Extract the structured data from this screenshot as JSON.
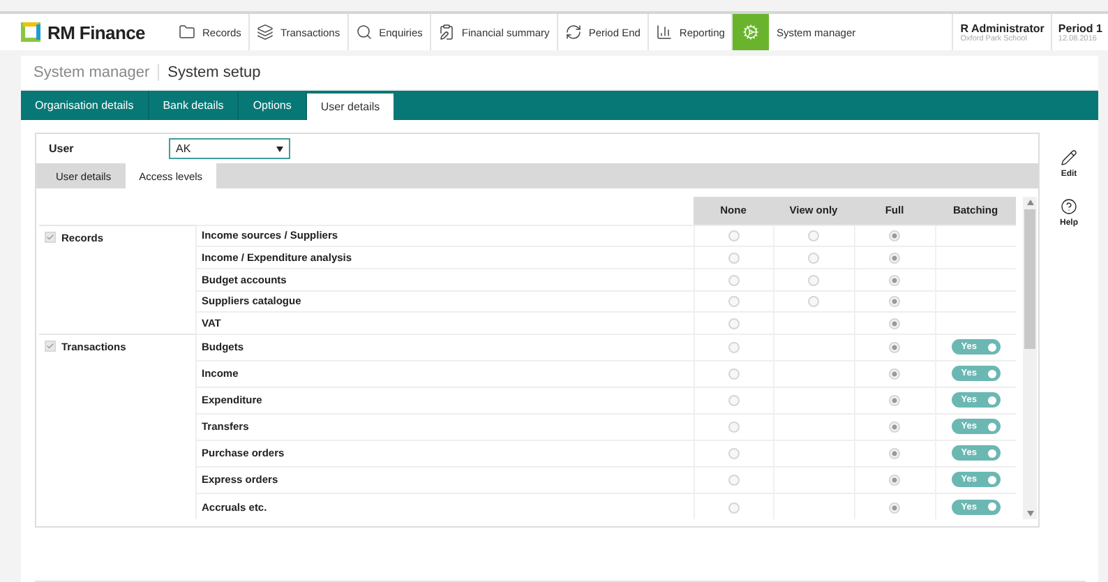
{
  "app": {
    "name": "RM Finance"
  },
  "nav": [
    {
      "kind": "records",
      "label": "Records",
      "selected": false
    },
    {
      "kind": "transactions",
      "label": "Transactions",
      "selected": false
    },
    {
      "kind": "enquiries",
      "label": "Enquiries",
      "selected": false
    },
    {
      "kind": "summary",
      "label": "Financial summary",
      "selected": false
    },
    {
      "kind": "period",
      "label": "Period End",
      "selected": false
    },
    {
      "kind": "reporting",
      "label": "Reporting",
      "selected": false
    },
    {
      "kind": "system",
      "label": "System manager",
      "selected": true
    }
  ],
  "user": {
    "name": "R Administrator",
    "org": "Oxford Park School"
  },
  "period": {
    "label": "Period 1",
    "date": "12.08.2016"
  },
  "breadcrumb": {
    "parent": "System manager",
    "current": "System setup"
  },
  "tabs": [
    {
      "label": "Organisation details",
      "selected": false
    },
    {
      "label": "Bank details",
      "selected": false
    },
    {
      "label": "Options",
      "selected": false
    },
    {
      "label": "User details",
      "selected": true
    }
  ],
  "user_field": {
    "label": "User",
    "value": "AK"
  },
  "subtabs": [
    {
      "label": "User details",
      "selected": false
    },
    {
      "label": "Access levels",
      "selected": true
    }
  ],
  "columns": [
    "None",
    "View only",
    "Full",
    "Batching"
  ],
  "groups": [
    {
      "name": "Records",
      "checked": true,
      "items": [
        {
          "label": "Income sources / Suppliers",
          "levels": [
            {
              "kind": "none",
              "selected": false
            },
            {
              "kind": "view",
              "selected": false
            },
            {
              "kind": "full",
              "selected": true
            }
          ]
        },
        {
          "label": "Income / Expenditure analysis",
          "levels": [
            {
              "kind": "none",
              "selected": false
            },
            {
              "kind": "view",
              "selected": false
            },
            {
              "kind": "full",
              "selected": true
            }
          ]
        },
        {
          "label": "Budget accounts",
          "levels": [
            {
              "kind": "none",
              "selected": false
            },
            {
              "kind": "view",
              "selected": false
            },
            {
              "kind": "full",
              "selected": true
            }
          ]
        },
        {
          "label": "Suppliers catalogue",
          "levels": [
            {
              "kind": "none",
              "selected": false
            },
            {
              "kind": "view",
              "selected": false
            },
            {
              "kind": "full",
              "selected": true
            }
          ]
        },
        {
          "label": "VAT",
          "levels": [
            {
              "kind": "none",
              "selected": false
            },
            {
              "kind": "full",
              "selected": true
            }
          ]
        }
      ]
    },
    {
      "name": "Transactions",
      "checked": true,
      "items": [
        {
          "label": "Budgets",
          "levels": [
            {
              "kind": "none",
              "selected": false
            },
            {
              "kind": "full",
              "selected": true
            }
          ],
          "batching": {
            "label": "Yes",
            "on": true
          }
        },
        {
          "label": "Income",
          "levels": [
            {
              "kind": "none",
              "selected": false
            },
            {
              "kind": "full",
              "selected": true
            }
          ],
          "batching": {
            "label": "Yes",
            "on": true
          }
        },
        {
          "label": "Expenditure",
          "levels": [
            {
              "kind": "none",
              "selected": false
            },
            {
              "kind": "full",
              "selected": true
            }
          ],
          "batching": {
            "label": "Yes",
            "on": true
          }
        },
        {
          "label": "Transfers",
          "levels": [
            {
              "kind": "none",
              "selected": false
            },
            {
              "kind": "full",
              "selected": true
            }
          ],
          "batching": {
            "label": "Yes",
            "on": true
          }
        },
        {
          "label": "Purchase orders",
          "levels": [
            {
              "kind": "none",
              "selected": false
            },
            {
              "kind": "full",
              "selected": true
            }
          ],
          "batching": {
            "label": "Yes",
            "on": true
          }
        },
        {
          "label": "Express orders",
          "levels": [
            {
              "kind": "none",
              "selected": false
            },
            {
              "kind": "full",
              "selected": true
            }
          ],
          "batching": {
            "label": "Yes",
            "on": true
          }
        },
        {
          "label": "Accruals etc.",
          "levels": [
            {
              "kind": "none",
              "selected": false
            },
            {
              "kind": "full",
              "selected": true
            }
          ],
          "batching": {
            "label": "Yes",
            "on": true
          }
        }
      ]
    }
  ],
  "actions": [
    {
      "kind": "edit",
      "label": "Edit"
    },
    {
      "kind": "help",
      "label": "Help"
    }
  ]
}
